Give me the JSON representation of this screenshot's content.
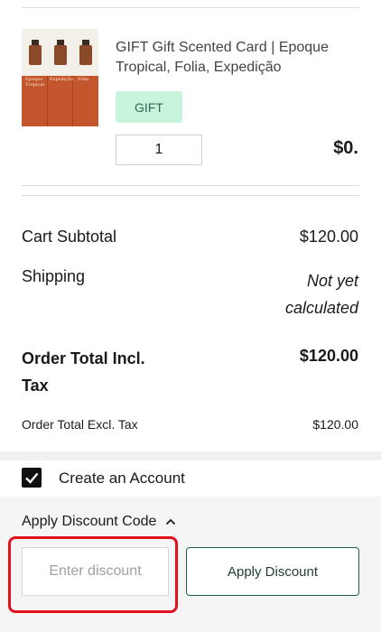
{
  "item": {
    "name": "GIFT Gift Scented Card | Epoque Tropical, Folia, Expedição",
    "badge": "GIFT",
    "quantity": "1",
    "price": "$0.",
    "thumbnail_labels": [
      "Epoque Tropical",
      "Expedição",
      "Folia"
    ]
  },
  "totals": {
    "subtotal_label": "Cart Subtotal",
    "subtotal_value": "$120.00",
    "shipping_label": "Shipping",
    "shipping_value_line1": "Not yet",
    "shipping_value_line2": "calculated",
    "order_total_line1": "Order Total Incl.",
    "order_total_line2": "Tax",
    "order_total_value": "$120.00",
    "order_excl_label": "Order Total Excl. Tax",
    "order_excl_value": "$120.00"
  },
  "account": {
    "label": "Create an Account",
    "checked": true
  },
  "discount": {
    "toggle_label": "Apply Discount Code",
    "placeholder": "Enter discount",
    "button_label": "Apply Discount"
  },
  "colors": {
    "badge_bg": "#c8f3dd",
    "button_border": "#1f5c47",
    "highlight": "#e3101d"
  }
}
